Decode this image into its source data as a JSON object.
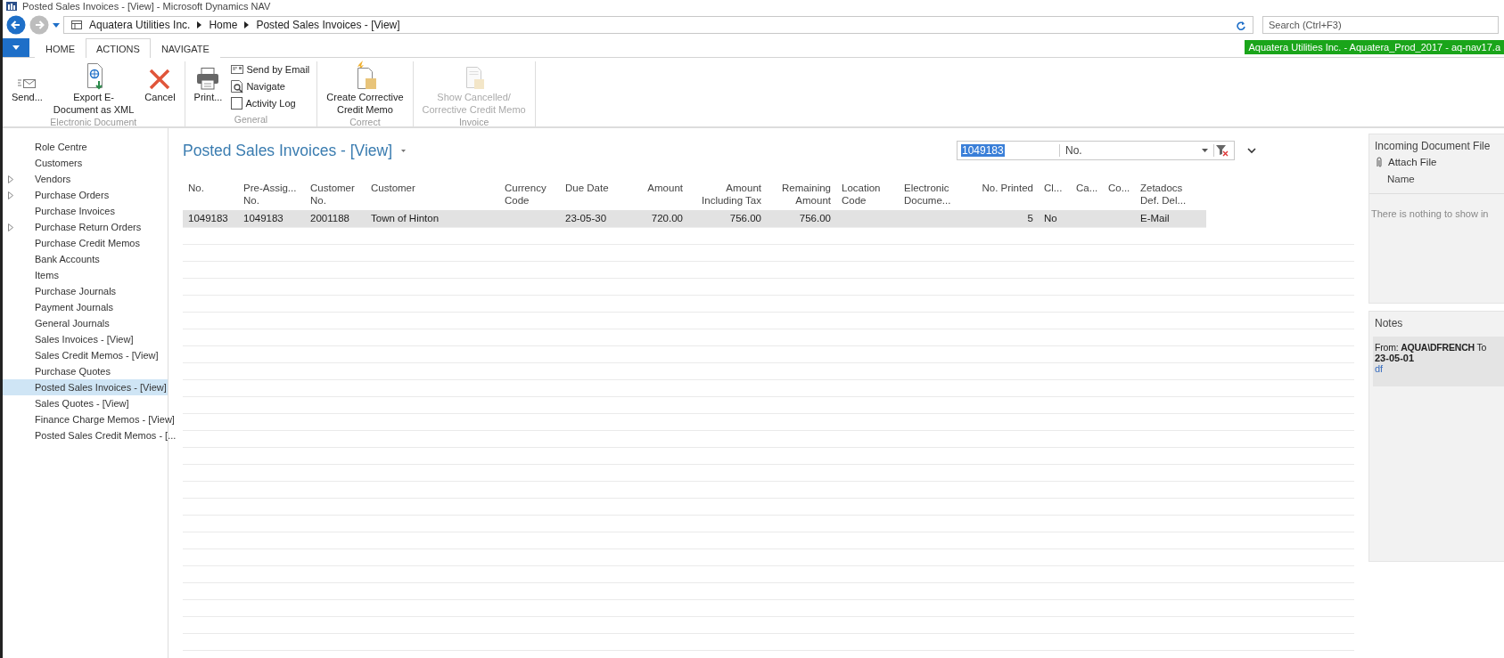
{
  "window": {
    "title": "Posted Sales Invoices - [View] - Microsoft Dynamics NAV"
  },
  "address_bar": {
    "breadcrumb": [
      "Aquatera Utilities Inc.",
      "Home",
      "Posted Sales Invoices - [View]"
    ],
    "search": {
      "placeholder": "Search (Ctrl+F3)"
    }
  },
  "ribbon": {
    "tabs": [
      {
        "label": "HOME",
        "selected": false
      },
      {
        "label": "ACTIONS",
        "selected": true
      },
      {
        "label": "NAVIGATE",
        "selected": false
      }
    ],
    "company_banner": "Aquatera Utilities Inc. - Aquatera_Prod_2017 - aq-nav17.a",
    "groups": [
      {
        "label": "Electronic Document",
        "items": [
          {
            "kind": "large",
            "lines": [
              "Send..."
            ],
            "disabled": false
          },
          {
            "kind": "large",
            "lines": [
              "Export E-",
              "Document as XML"
            ],
            "disabled": false
          },
          {
            "kind": "large",
            "lines": [
              "Cancel"
            ],
            "disabled": false
          }
        ]
      },
      {
        "label": "General",
        "items": [
          {
            "kind": "large",
            "lines": [
              "Print..."
            ],
            "disabled": false
          },
          {
            "kind": "small",
            "lines": [
              "Send by Email"
            ],
            "disabled": false
          },
          {
            "kind": "small",
            "lines": [
              "Navigate"
            ],
            "disabled": false
          },
          {
            "kind": "small",
            "lines": [
              "Activity Log"
            ],
            "disabled": false
          }
        ]
      },
      {
        "label": "Correct",
        "items": [
          {
            "kind": "large",
            "lines": [
              "Create Corrective",
              "Credit Memo"
            ],
            "disabled": false
          }
        ]
      },
      {
        "label": "Invoice",
        "items": [
          {
            "kind": "large",
            "lines": [
              "Show Cancelled/",
              "Corrective Credit Memo"
            ],
            "disabled": true
          }
        ]
      }
    ]
  },
  "sidebar": {
    "items": [
      {
        "label": "Role Centre",
        "kind": "link",
        "selected": false
      },
      {
        "label": "Customers",
        "kind": "link",
        "selected": false
      },
      {
        "label": "Vendors",
        "kind": "group",
        "selected": false
      },
      {
        "label": "Purchase Orders",
        "kind": "group",
        "selected": false
      },
      {
        "label": "Purchase Invoices",
        "kind": "link",
        "selected": false
      },
      {
        "label": "Purchase Return Orders",
        "kind": "group",
        "selected": false
      },
      {
        "label": "Purchase Credit Memos",
        "kind": "link",
        "selected": false
      },
      {
        "label": "Bank Accounts",
        "kind": "link",
        "selected": false
      },
      {
        "label": "Items",
        "kind": "link",
        "selected": false
      },
      {
        "label": "Purchase Journals",
        "kind": "link",
        "selected": false
      },
      {
        "label": "Payment Journals",
        "kind": "link",
        "selected": false
      },
      {
        "label": "General Journals",
        "kind": "link",
        "selected": false
      },
      {
        "label": "Sales Invoices - [View]",
        "kind": "link",
        "selected": false
      },
      {
        "label": "Sales Credit Memos - [View]",
        "kind": "link",
        "selected": false
      },
      {
        "label": "Purchase Quotes",
        "kind": "link",
        "selected": false
      },
      {
        "label": "Posted Sales Invoices - [View]",
        "kind": "link",
        "selected": true
      },
      {
        "label": "Sales Quotes - [View]",
        "kind": "link",
        "selected": false
      },
      {
        "label": "Finance Charge Memos - [View]",
        "kind": "link",
        "selected": false
      },
      {
        "label": "Posted Sales Credit Memos - [...",
        "kind": "link",
        "selected": false
      }
    ]
  },
  "page": {
    "title": "Posted Sales Invoices - [View]",
    "filter": {
      "value": "1049183",
      "value_selected": true,
      "field": "No."
    },
    "table": {
      "columns": [
        {
          "lines": [
            "No."
          ],
          "kind": "text"
        },
        {
          "lines": [
            "Pre-Assig...",
            "No."
          ],
          "kind": "text"
        },
        {
          "lines": [
            "Customer",
            "No."
          ],
          "kind": "text"
        },
        {
          "lines": [
            "Customer"
          ],
          "kind": "text"
        },
        {
          "lines": [
            "Currency",
            "Code"
          ],
          "kind": "text"
        },
        {
          "lines": [
            "Due Date"
          ],
          "kind": "text"
        },
        {
          "lines": [
            "Amount"
          ],
          "kind": "number"
        },
        {
          "lines": [
            "Amount",
            "Including Tax"
          ],
          "kind": "number"
        },
        {
          "lines": [
            "Remaining",
            "Amount"
          ],
          "kind": "number"
        },
        {
          "lines": [
            "Location",
            "Code"
          ],
          "kind": "text"
        },
        {
          "lines": [
            "Electronic",
            "Docume..."
          ],
          "kind": "text"
        },
        {
          "lines": [
            "No. Printed"
          ],
          "kind": "number"
        },
        {
          "lines": [
            "Cl..."
          ],
          "kind": "text"
        },
        {
          "lines": [
            "Ca..."
          ],
          "kind": "text"
        },
        {
          "lines": [
            "Co..."
          ],
          "kind": "text"
        },
        {
          "lines": [
            "Zetadocs",
            "Def. Del..."
          ],
          "kind": "text"
        }
      ],
      "rows": [
        {
          "selected": true,
          "cells": [
            "1049183",
            "1049183",
            "2001188",
            "Town of Hinton",
            "",
            "23-05-30",
            "720.00",
            "756.00",
            "756.00",
            "",
            "",
            "5",
            "No",
            "",
            "",
            "E-Mail"
          ]
        }
      ]
    }
  },
  "factbox": {
    "incoming_documents": {
      "title": "Incoming Document File",
      "action": "Attach File",
      "column": "Name",
      "empty_text": "There is nothing to show in"
    },
    "notes": {
      "title": "Notes",
      "items": [
        {
          "header": "From: **AQUA\\DFRENCH** To",
          "date": "23-05-01",
          "text": "df"
        }
      ]
    }
  }
}
